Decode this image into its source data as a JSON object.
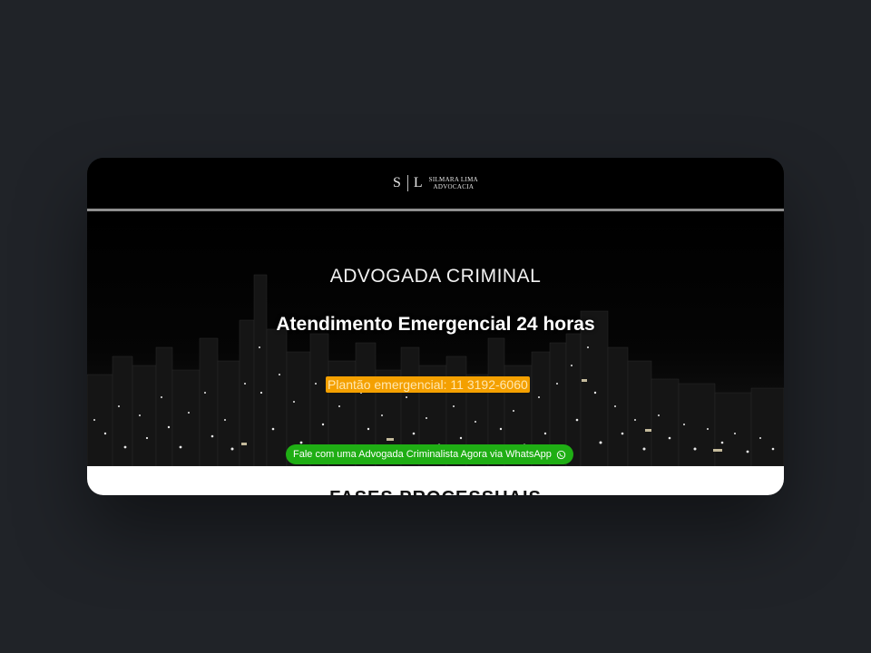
{
  "logo": {
    "monogram_left": "S",
    "monogram_right": "L",
    "line1": "SILMARA LIMA",
    "line2": "ADVOCACIA"
  },
  "hero": {
    "title": "ADVOGADA CRIMINAL",
    "subtitle": "Atendimento Emergencial 24 horas",
    "plantao": "Plantão emergencial: 11 3192-6060",
    "whatsapp_button": "Fale com uma Advogada Criminalista Agora via WhatsApp"
  },
  "section": {
    "heading": "FASES PROCESSUAIS"
  },
  "colors": {
    "page_background": "#202328",
    "plantao_highlight": "#f4a000",
    "whatsapp_green": "#1fae14"
  },
  "icons": {
    "whatsapp": "whatsapp-icon"
  }
}
